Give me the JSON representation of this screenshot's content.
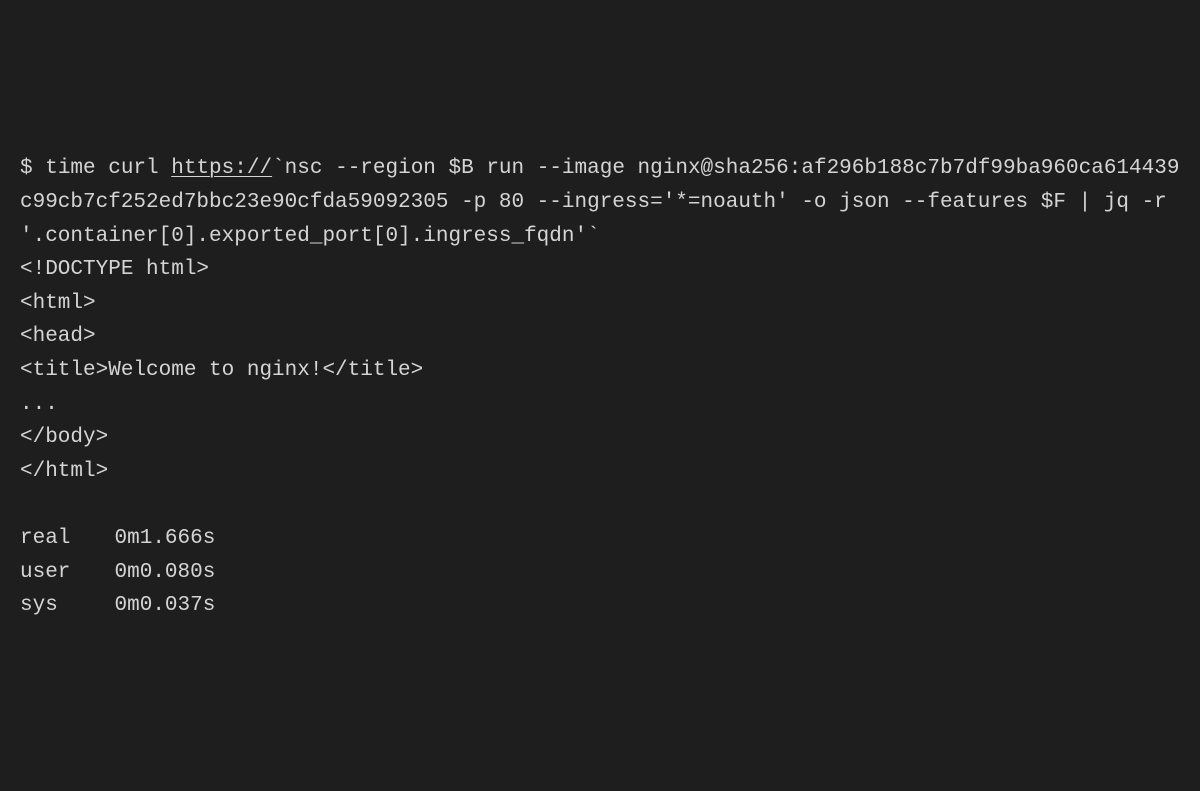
{
  "prompt": "$ ",
  "command": {
    "pre_underline": "time curl ",
    "underlined": "https://",
    "post_underline": "`nsc --region $B run --image nginx@sha256:af296b188c7b7df99ba960ca614439c99cb7cf252ed7bbc23e90cfda59092305 -p 80 --ingress='*=noauth' -o json --features $F | jq -r '.container[0].exported_port[0].ingress_fqdn'`"
  },
  "output_lines": [
    "<!DOCTYPE html>",
    "<html>",
    "<head>",
    "<title>Welcome to nginx!</title>",
    "...",
    "</body>",
    "</html>"
  ],
  "timing": [
    {
      "label": "real",
      "value": "0m1.666s"
    },
    {
      "label": "user",
      "value": "0m0.080s"
    },
    {
      "label": "sys",
      "value": "0m0.037s"
    }
  ]
}
